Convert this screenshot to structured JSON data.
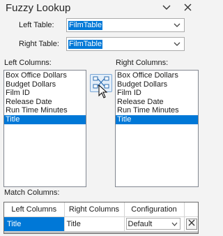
{
  "pane": {
    "title": "Fuzzy Lookup",
    "icons": {
      "dropdown": "chevron-down-icon",
      "close": "close-icon"
    }
  },
  "left_table": {
    "label": "Left Table:",
    "value": "FilmTable"
  },
  "right_table": {
    "label": "Right Table:",
    "value": "FilmTable"
  },
  "left_columns": {
    "label": "Left Columns:",
    "items": [
      "Box Office Dollars",
      "Budget Dollars",
      "Film ID",
      "Release Date",
      "Run Time Minutes",
      "Title"
    ],
    "selected": "Title"
  },
  "right_columns": {
    "label": "Right Columns:",
    "items": [
      "Box Office Dollars",
      "Budget Dollars",
      "Film ID",
      "Release Date",
      "Run Time Minutes",
      "Title"
    ],
    "selected": "Title"
  },
  "map_button_icon": "column-mapping-icon",
  "match_columns": {
    "label": "Match Columns:",
    "headers": [
      "Left Columns",
      "Right Columns",
      "Configuration"
    ],
    "rows": [
      {
        "left": "Title",
        "right": "Title",
        "configuration": "Default"
      }
    ]
  },
  "colors": {
    "accent": "#0078d7",
    "background": "#f3f3f3"
  }
}
